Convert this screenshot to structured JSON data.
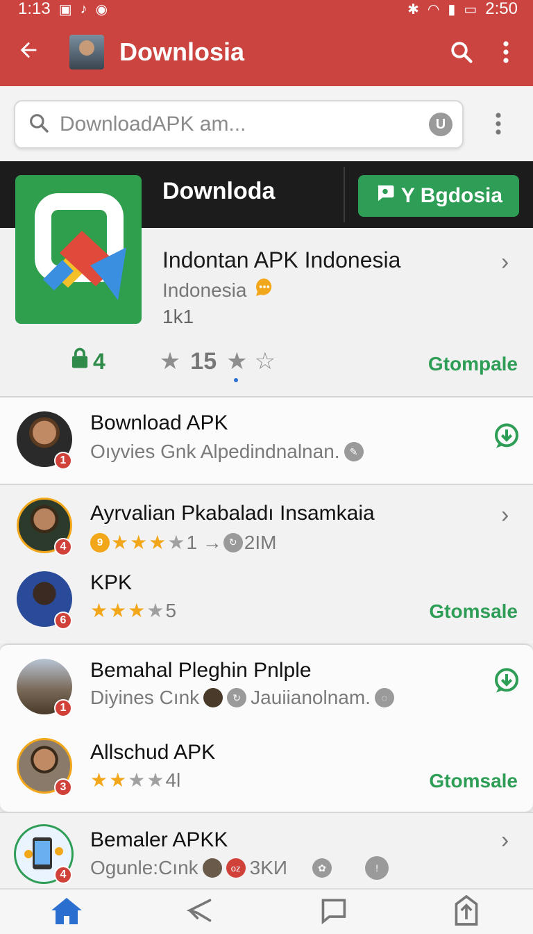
{
  "status_bar": {
    "time_left": "1:13",
    "time_right": "2:50"
  },
  "app_bar": {
    "title": "Downlosia",
    "back_icon": "arrow-left-icon",
    "search_icon": "search-icon",
    "more_icon": "more-vert-icon"
  },
  "search": {
    "placeholder": "DownloadAPK am...",
    "mic_icon": "mic-icon"
  },
  "featured": {
    "header": "Downloda",
    "button_label": "Y Bgdosia",
    "name": "Indontan APK Indonesia",
    "country": "Indonesia",
    "count": "1k1",
    "lock_count": "4",
    "rating": "15",
    "tag": "Gtompale"
  },
  "list": [
    {
      "title": "Bownload APK",
      "subtitle": "Oıyvies Gnk Alpedindnalnan.",
      "badge": "1",
      "action": "download"
    },
    {
      "title": "Ayrvalian Pkabaladı Insamkaia",
      "badge": "4",
      "chip": "9",
      "stars_filled": 3,
      "stars_empty": 1,
      "meta_a": "1 →",
      "meta_b": "2IM",
      "action": "chevron"
    },
    {
      "title": "KPK",
      "badge": "6",
      "stars_filled": 3,
      "stars_empty": 1,
      "meta_a": "5",
      "tag": "Gtomsale",
      "action": "tag"
    },
    {
      "title": "Bemahal Pleghin Pnlple",
      "subtitle_a": "Diyines Cınk",
      "subtitle_b": "Jauiianolnam.",
      "badge": "1",
      "action": "download"
    },
    {
      "title": "Allschud APK",
      "badge": "3",
      "stars_filled": 2,
      "stars_empty": 2,
      "meta_a": "4l",
      "tag": "Gtomsale",
      "action": "tag"
    },
    {
      "title": "Bemaler APKK",
      "subtitle": "Ogunle:Cınk",
      "chip_red": "oz",
      "meta_b": "3KИ",
      "badge": "4",
      "action": "chevron"
    }
  ],
  "bottom_nav": [
    "home-icon",
    "share-icon",
    "chat-icon",
    "upload-icon"
  ],
  "colors": {
    "primary": "#cc4440",
    "accent_green": "#2e9e57",
    "star": "#f2a71b",
    "badge": "#d0413a"
  }
}
